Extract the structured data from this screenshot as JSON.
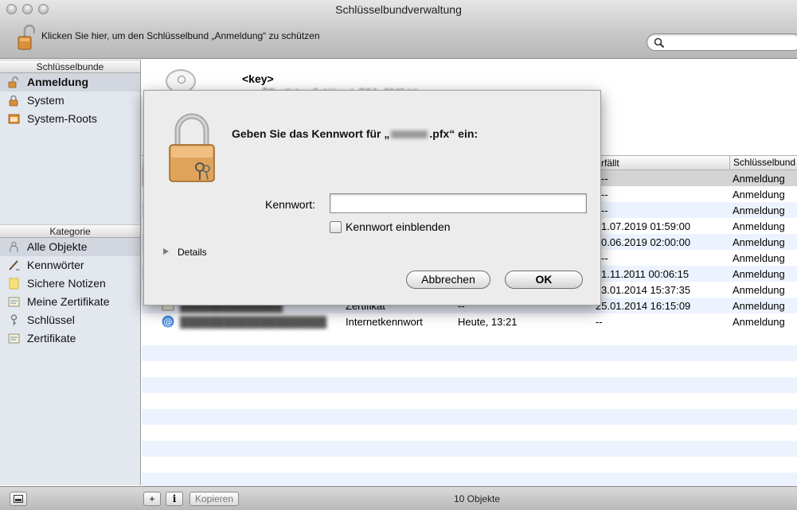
{
  "window": {
    "title": "Schlüsselbundverwaltung",
    "lock_message": "Klicken Sie hier, um den Schlüsselbund „Anmeldung“ zu schützen"
  },
  "search": {
    "placeholder": "",
    "value": ""
  },
  "sidebar": {
    "keychains_header": "Schlüsselbunde",
    "keychains": [
      {
        "label": "Anmeldung",
        "icon": "unlocked-padlock-icon",
        "selected": true
      },
      {
        "label": "System",
        "icon": "padlock-icon",
        "selected": false
      },
      {
        "label": "System-Roots",
        "icon": "folder-icon",
        "selected": false
      }
    ],
    "category_header": "Kategorie",
    "categories": [
      {
        "label": "Alle Objekte",
        "icon": "people-icon",
        "selected": true
      },
      {
        "label": "Kennwörter",
        "icon": "pen-icon",
        "selected": false
      },
      {
        "label": "Sichere Notizen",
        "icon": "note-icon",
        "selected": false
      },
      {
        "label": "Meine Zertifikate",
        "icon": "certificate-icon",
        "selected": false
      },
      {
        "label": "Schlüssel",
        "icon": "key-icon",
        "selected": false
      },
      {
        "label": "Zertifikate",
        "icon": "certificate-icon",
        "selected": false
      }
    ]
  },
  "detail": {
    "title": "<key>",
    "subtitle": "Öffentlicher Schlüssel, RSA, 2048 bit"
  },
  "table": {
    "headers": [
      "rfällt",
      "Schlüsselbund"
    ],
    "rows": [
      {
        "kind": "",
        "modified": "",
        "expires": "--",
        "keychain": "Anmeldung"
      },
      {
        "kind": "",
        "modified": "",
        "expires": "--",
        "keychain": "Anmeldung"
      },
      {
        "kind": "",
        "modified": "",
        "expires": "--",
        "keychain": "Anmeldung"
      },
      {
        "kind": "",
        "modified": "",
        "expires": "1.07.2019 01:59:00",
        "keychain": "Anmeldung"
      },
      {
        "kind": "",
        "modified": "",
        "expires": "0.06.2019 02:00:00",
        "keychain": "Anmeldung"
      },
      {
        "kind": "",
        "modified": "",
        "expires": "--",
        "keychain": "Anmeldung"
      },
      {
        "kind": "",
        "modified": "",
        "expires": "1.11.2011 00:06:15",
        "keychain": "Anmeldung"
      },
      {
        "kind": "",
        "modified": "",
        "expires": "3.01.2014 15:37:35",
        "keychain": "Anmeldung"
      },
      {
        "kind": "Zertifikat",
        "modified": "--",
        "expires": "25.01.2014 16:15:09",
        "keychain": "Anmeldung"
      },
      {
        "kind": "Internetkennwort",
        "modified": "Heute, 13:21",
        "expires": "--",
        "keychain": "Anmeldung"
      }
    ]
  },
  "bottom": {
    "add_label": "+",
    "info_label": "i",
    "copy_label": "Kopieren",
    "count": "10 Objekte"
  },
  "dialog": {
    "message_before": "Geben Sie das Kennwort für „",
    "message_after": ".pfx“ ein:",
    "password_label": "Kennwort:",
    "password_value": "",
    "show_password_label": "Kennwort einblenden",
    "show_password_checked": false,
    "details_label": "Details",
    "cancel_label": "Abbrechen",
    "ok_label": "OK"
  },
  "colors": {
    "sidebar_bg": "#e3e7ee",
    "row_stripe": "#edf3fe",
    "selected_row": "#d4d4d4",
    "dialog_bg": "#ececec"
  }
}
